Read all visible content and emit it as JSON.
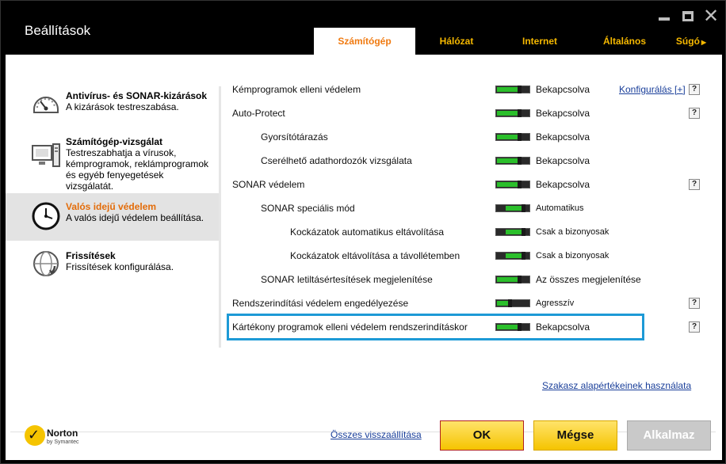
{
  "window": {
    "title": "Beállítások"
  },
  "tabs": [
    {
      "label": "Számítógép",
      "active": true
    },
    {
      "label": "Hálózat",
      "active": false
    },
    {
      "label": "Internet",
      "active": false
    },
    {
      "label": "Általános",
      "active": false
    },
    {
      "label": "Súgó",
      "active": false
    }
  ],
  "sidebar": {
    "items": [
      {
        "title": "Antivírus- és SONAR-kizárások",
        "desc": "A kizárások testreszabása.",
        "icon": "gauge-icon",
        "active": false
      },
      {
        "title": "Számítógép-vizsgálat",
        "desc": "Testreszabhatja a vírusok, kémprogramok, reklámprogramok és egyéb fenyegetések vizsgálatát.",
        "icon": "computer-icon",
        "active": false
      },
      {
        "title": "Valós idejű védelem",
        "desc": "A valós idejű védelem beállítása.",
        "icon": "clock-icon",
        "active": true
      },
      {
        "title": "Frissítések",
        "desc": "Frissítések konfigurálása.",
        "icon": "globe-update-icon",
        "active": false
      }
    ]
  },
  "settings": {
    "rows": [
      {
        "label": "Kémprogramok elleni védelem",
        "value": "Bekapcsolva",
        "state": "on",
        "configure": "Konfigurálás [+]",
        "help": "?"
      },
      {
        "label": "Auto-Protect",
        "value": "Bekapcsolva",
        "state": "on",
        "help": "?"
      },
      {
        "label": "Gyorsítótárazás",
        "value": "Bekapcsolva",
        "state": "on"
      },
      {
        "label": "Cserélhető adathordozók vizsgálata",
        "value": "Bekapcsolva",
        "state": "on"
      },
      {
        "label": "SONAR védelem",
        "value": "Bekapcsolva",
        "state": "on",
        "help": "?"
      },
      {
        "label": "SONAR speciális mód",
        "value": "Automatikus",
        "state": "mid"
      },
      {
        "label": "Kockázatok automatikus eltávolítása",
        "value": "Csak a bizonyosak",
        "state": "mid"
      },
      {
        "label": "Kockázatok eltávolítása a távollétemben",
        "value": "Csak a bizonyosak",
        "state": "mid"
      },
      {
        "label": "SONAR letiltásértesítések megjelenítése",
        "value": "Az összes megjelenítése",
        "state": "on"
      },
      {
        "label": "Rendszerindítási védelem engedélyezése",
        "value": "Agresszív",
        "state": "low",
        "help": "?"
      },
      {
        "label": "Kártékony programok elleni védelem rendszerindításkor",
        "value": "Bekapcsolva",
        "state": "on",
        "help": "?"
      }
    ],
    "section_defaults_link": "Szakasz alapértékeinek használata"
  },
  "footer": {
    "brand_name": "Norton",
    "brand_sub": "by Symantec",
    "reset_all_link": "Összes visszaállítása",
    "ok_label": "OK",
    "cancel_label": "Mégse",
    "apply_label": "Alkalmaz"
  },
  "colors": {
    "accent_orange": "#f07a10",
    "tab_yellow": "#f5b800",
    "toggle_green": "#2bbf2b",
    "highlight_blue": "#1d9ad6",
    "button_yellow": "#f5c400"
  }
}
